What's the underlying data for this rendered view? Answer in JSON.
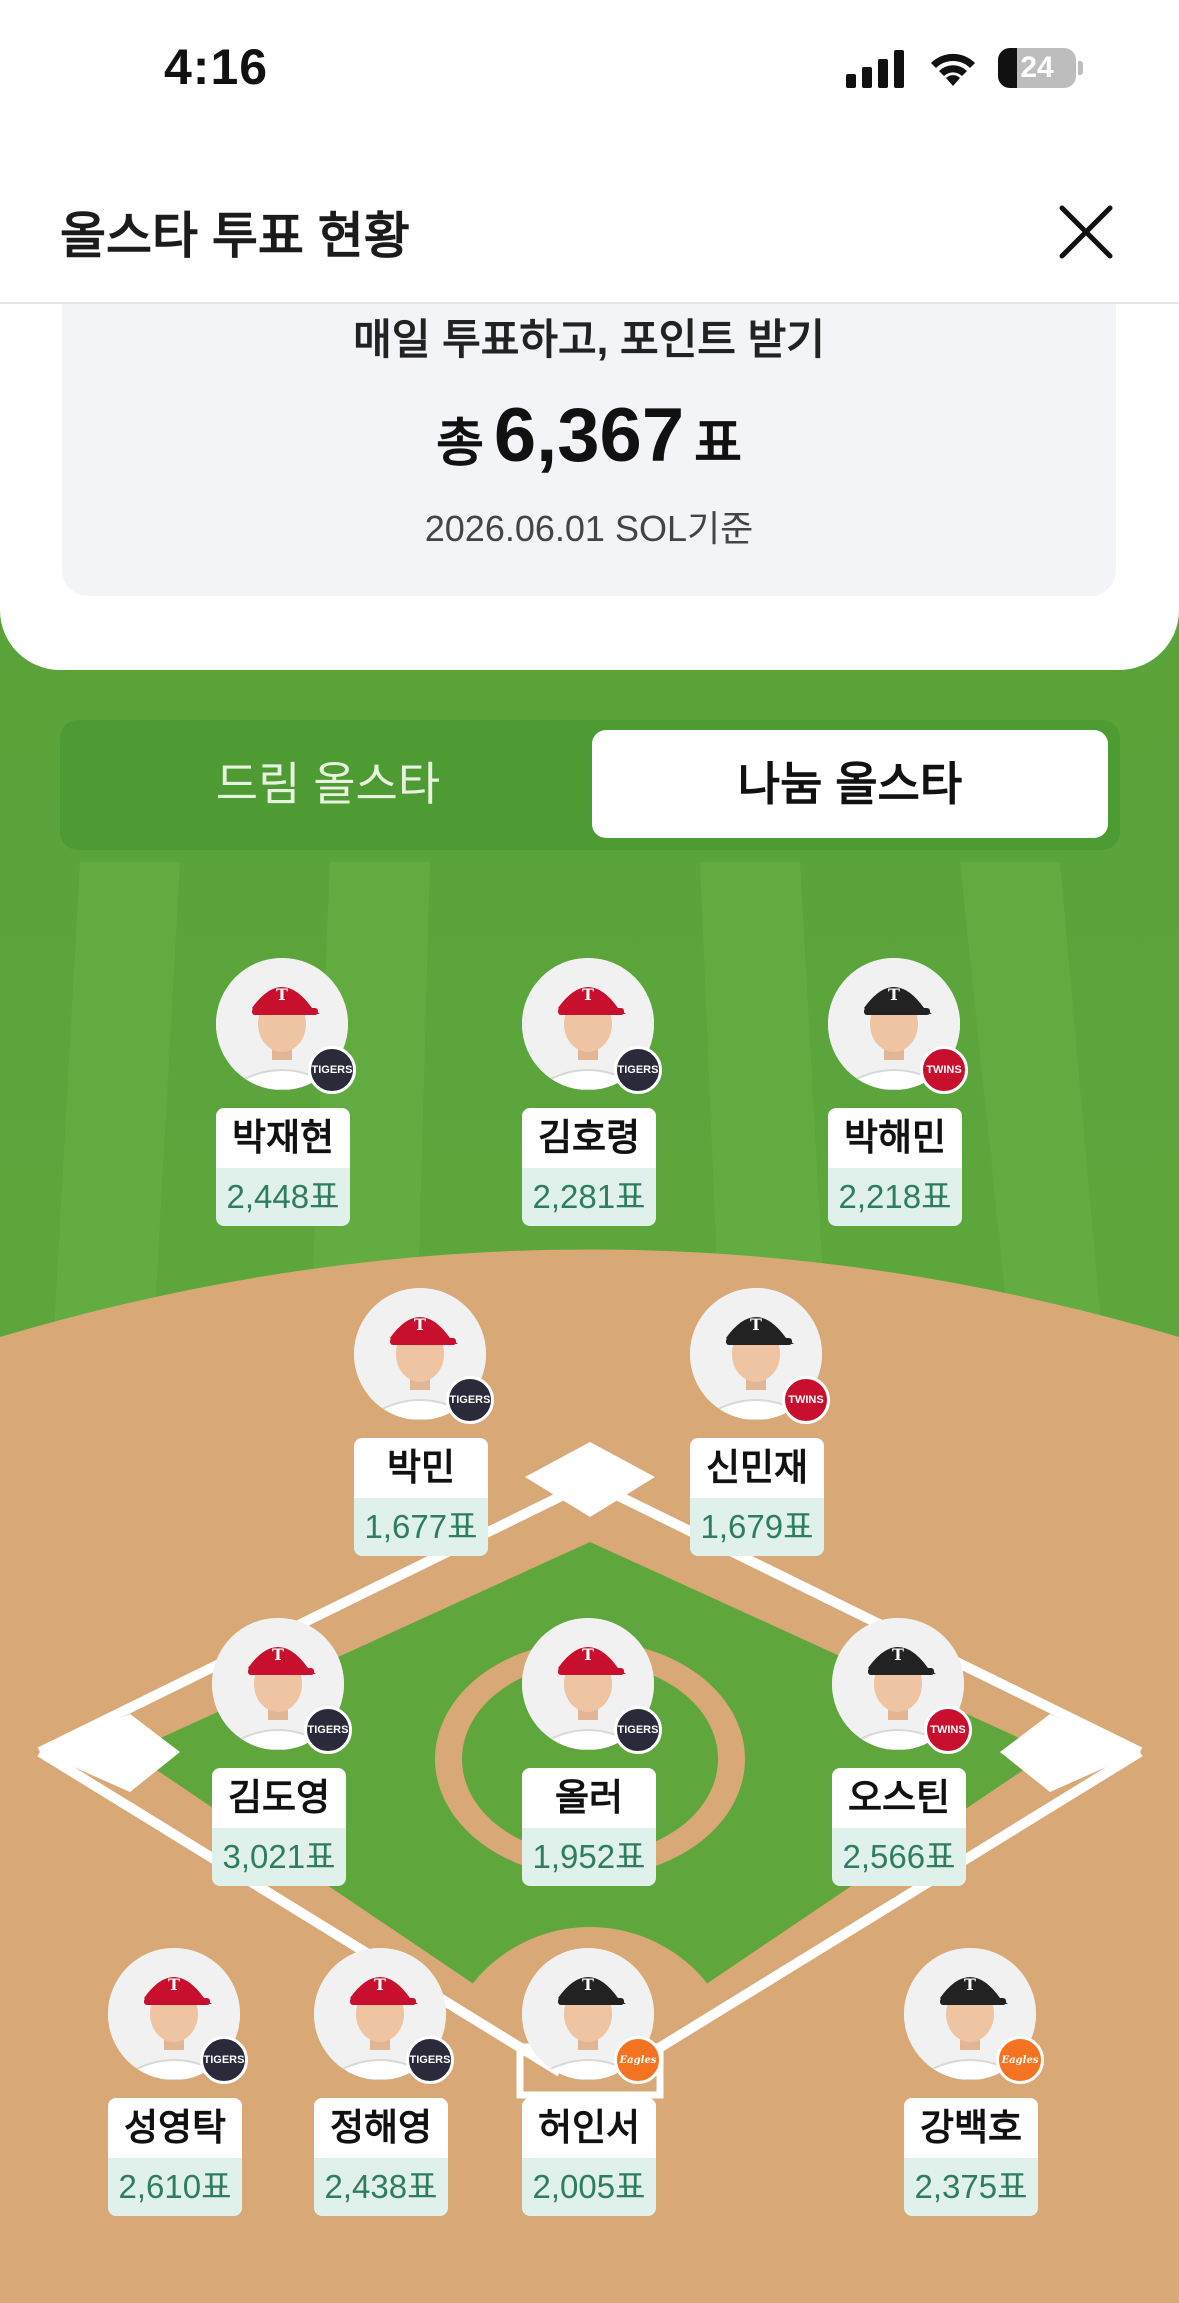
{
  "status_bar": {
    "time": "4:16",
    "battery": "24",
    "battery_level": 0.24
  },
  "header": {
    "title": "올스타 투표 현황",
    "close_icon": "close-icon"
  },
  "summary": {
    "subtitle": "매일 투표하고, 포인트 받기",
    "total_prefix": "총",
    "total_votes": "6,367",
    "total_suffix": "표",
    "date_note": "2026.06.01 SOL기준"
  },
  "tabs": [
    {
      "label": "드림 올스타",
      "selected": false
    },
    {
      "label": "나눔 올스타",
      "selected": true
    }
  ],
  "colors": {
    "grass": "#5ea43c",
    "infield": "#d9a877",
    "tab_bg": "#4e9a33",
    "votes_text": "#2f7d5f",
    "votes_bg": "#dff1ea"
  },
  "players": [
    {
      "name": "박재현",
      "votes": "2,448표",
      "team": "tigers",
      "badge": "TIGERS",
      "cap": "#c8102e"
    },
    {
      "name": "김호령",
      "votes": "2,281표",
      "team": "tigers",
      "badge": "TIGERS",
      "cap": "#c8102e"
    },
    {
      "name": "박해민",
      "votes": "2,218표",
      "team": "twins",
      "badge": "TWINS",
      "cap": "#222222"
    },
    {
      "name": "박민",
      "votes": "1,677표",
      "team": "tigers",
      "badge": "TIGERS",
      "cap": "#c8102e"
    },
    {
      "name": "신민재",
      "votes": "1,679표",
      "team": "twins",
      "badge": "TWINS",
      "cap": "#222222"
    },
    {
      "name": "김도영",
      "votes": "3,021표",
      "team": "tigers",
      "badge": "TIGERS",
      "cap": "#c8102e"
    },
    {
      "name": "올러",
      "votes": "1,952표",
      "team": "tigers",
      "badge": "TIGERS",
      "cap": "#c8102e"
    },
    {
      "name": "오스틴",
      "votes": "2,566표",
      "team": "twins",
      "badge": "TWINS",
      "cap": "#222222"
    },
    {
      "name": "성영탁",
      "votes": "2,610표",
      "team": "tigers",
      "badge": "TIGERS",
      "cap": "#c8102e"
    },
    {
      "name": "정해영",
      "votes": "2,438표",
      "team": "tigers",
      "badge": "TIGERS",
      "cap": "#c8102e"
    },
    {
      "name": "허인서",
      "votes": "2,005표",
      "team": "eagles",
      "badge": "Eagles",
      "cap": "#222222"
    },
    {
      "name": "강백호",
      "votes": "2,375표",
      "team": "eagles",
      "badge": "Eagles",
      "cap": "#222222"
    }
  ]
}
